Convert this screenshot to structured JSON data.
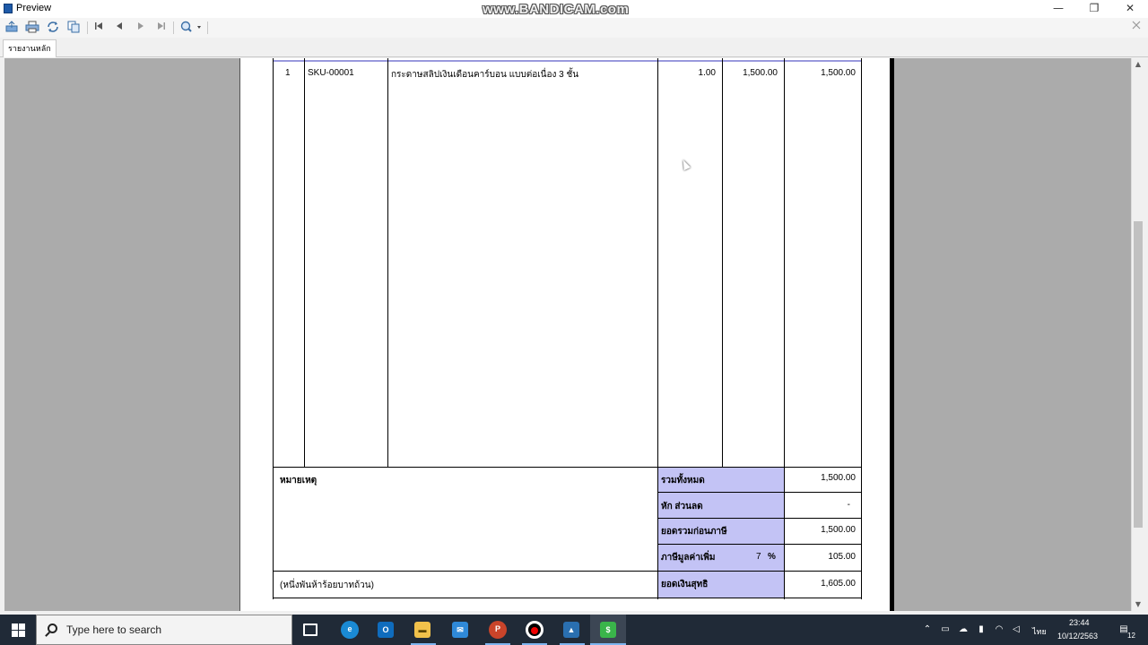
{
  "window": {
    "title": "Preview",
    "watermark": "www.BANDICAM.com",
    "minimize": "—",
    "restore": "❐",
    "close": "✕"
  },
  "toolbar": {
    "icons": [
      "export-icon",
      "print-icon",
      "refresh-icon",
      "copy-icon",
      "first-page-icon",
      "prev-page-icon",
      "next-page-icon",
      "last-page-icon",
      "zoom-icon"
    ],
    "close_icon": "close-icon"
  },
  "tabs": [
    {
      "label": "รายงานหลัก"
    }
  ],
  "document": {
    "row": {
      "index": "1",
      "sku": "SKU-00001",
      "description": "กระดาษสลิปเงินเดือนคาร์บอน แบบต่อเนื่อง 3 ชั้น",
      "qty": "1.00",
      "unit_price": "1,500.00",
      "amount": "1,500.00"
    },
    "remark_label": "หมายเหตุ",
    "amount_in_words": "(หนึ่งพันห้าร้อยบาทถ้วน)",
    "summary": {
      "total_label": "รวมทั้งหมด",
      "total_value": "1,500.00",
      "discount_label": "หัก ส่วนลด",
      "discount_value": "-",
      "pre_tax_label": "ยอดรวมก่อนภาษี",
      "pre_tax_value": "1,500.00",
      "vat_label": "ภาษีมูลค่าเพิ่ม",
      "vat_rate": "7",
      "vat_percent": "%",
      "vat_value": "105.00",
      "net_label": "ยอดเงินสุทธิ",
      "net_value": "1,605.00"
    },
    "colors": {
      "label_bg": "#c3c3f5",
      "viewer_bg": "#ababab"
    }
  },
  "taskbar": {
    "search_placeholder": "Type here to search",
    "language": "ไทย",
    "time": "23:44",
    "date": "10/12/2563",
    "notification_count": "12",
    "apps": [
      "task-view-icon",
      "edge-icon",
      "outlook-icon",
      "file-explorer-icon",
      "mail-icon",
      "powerpoint-icon",
      "bandicam-icon",
      "photos-icon",
      "line-app-icon"
    ]
  }
}
